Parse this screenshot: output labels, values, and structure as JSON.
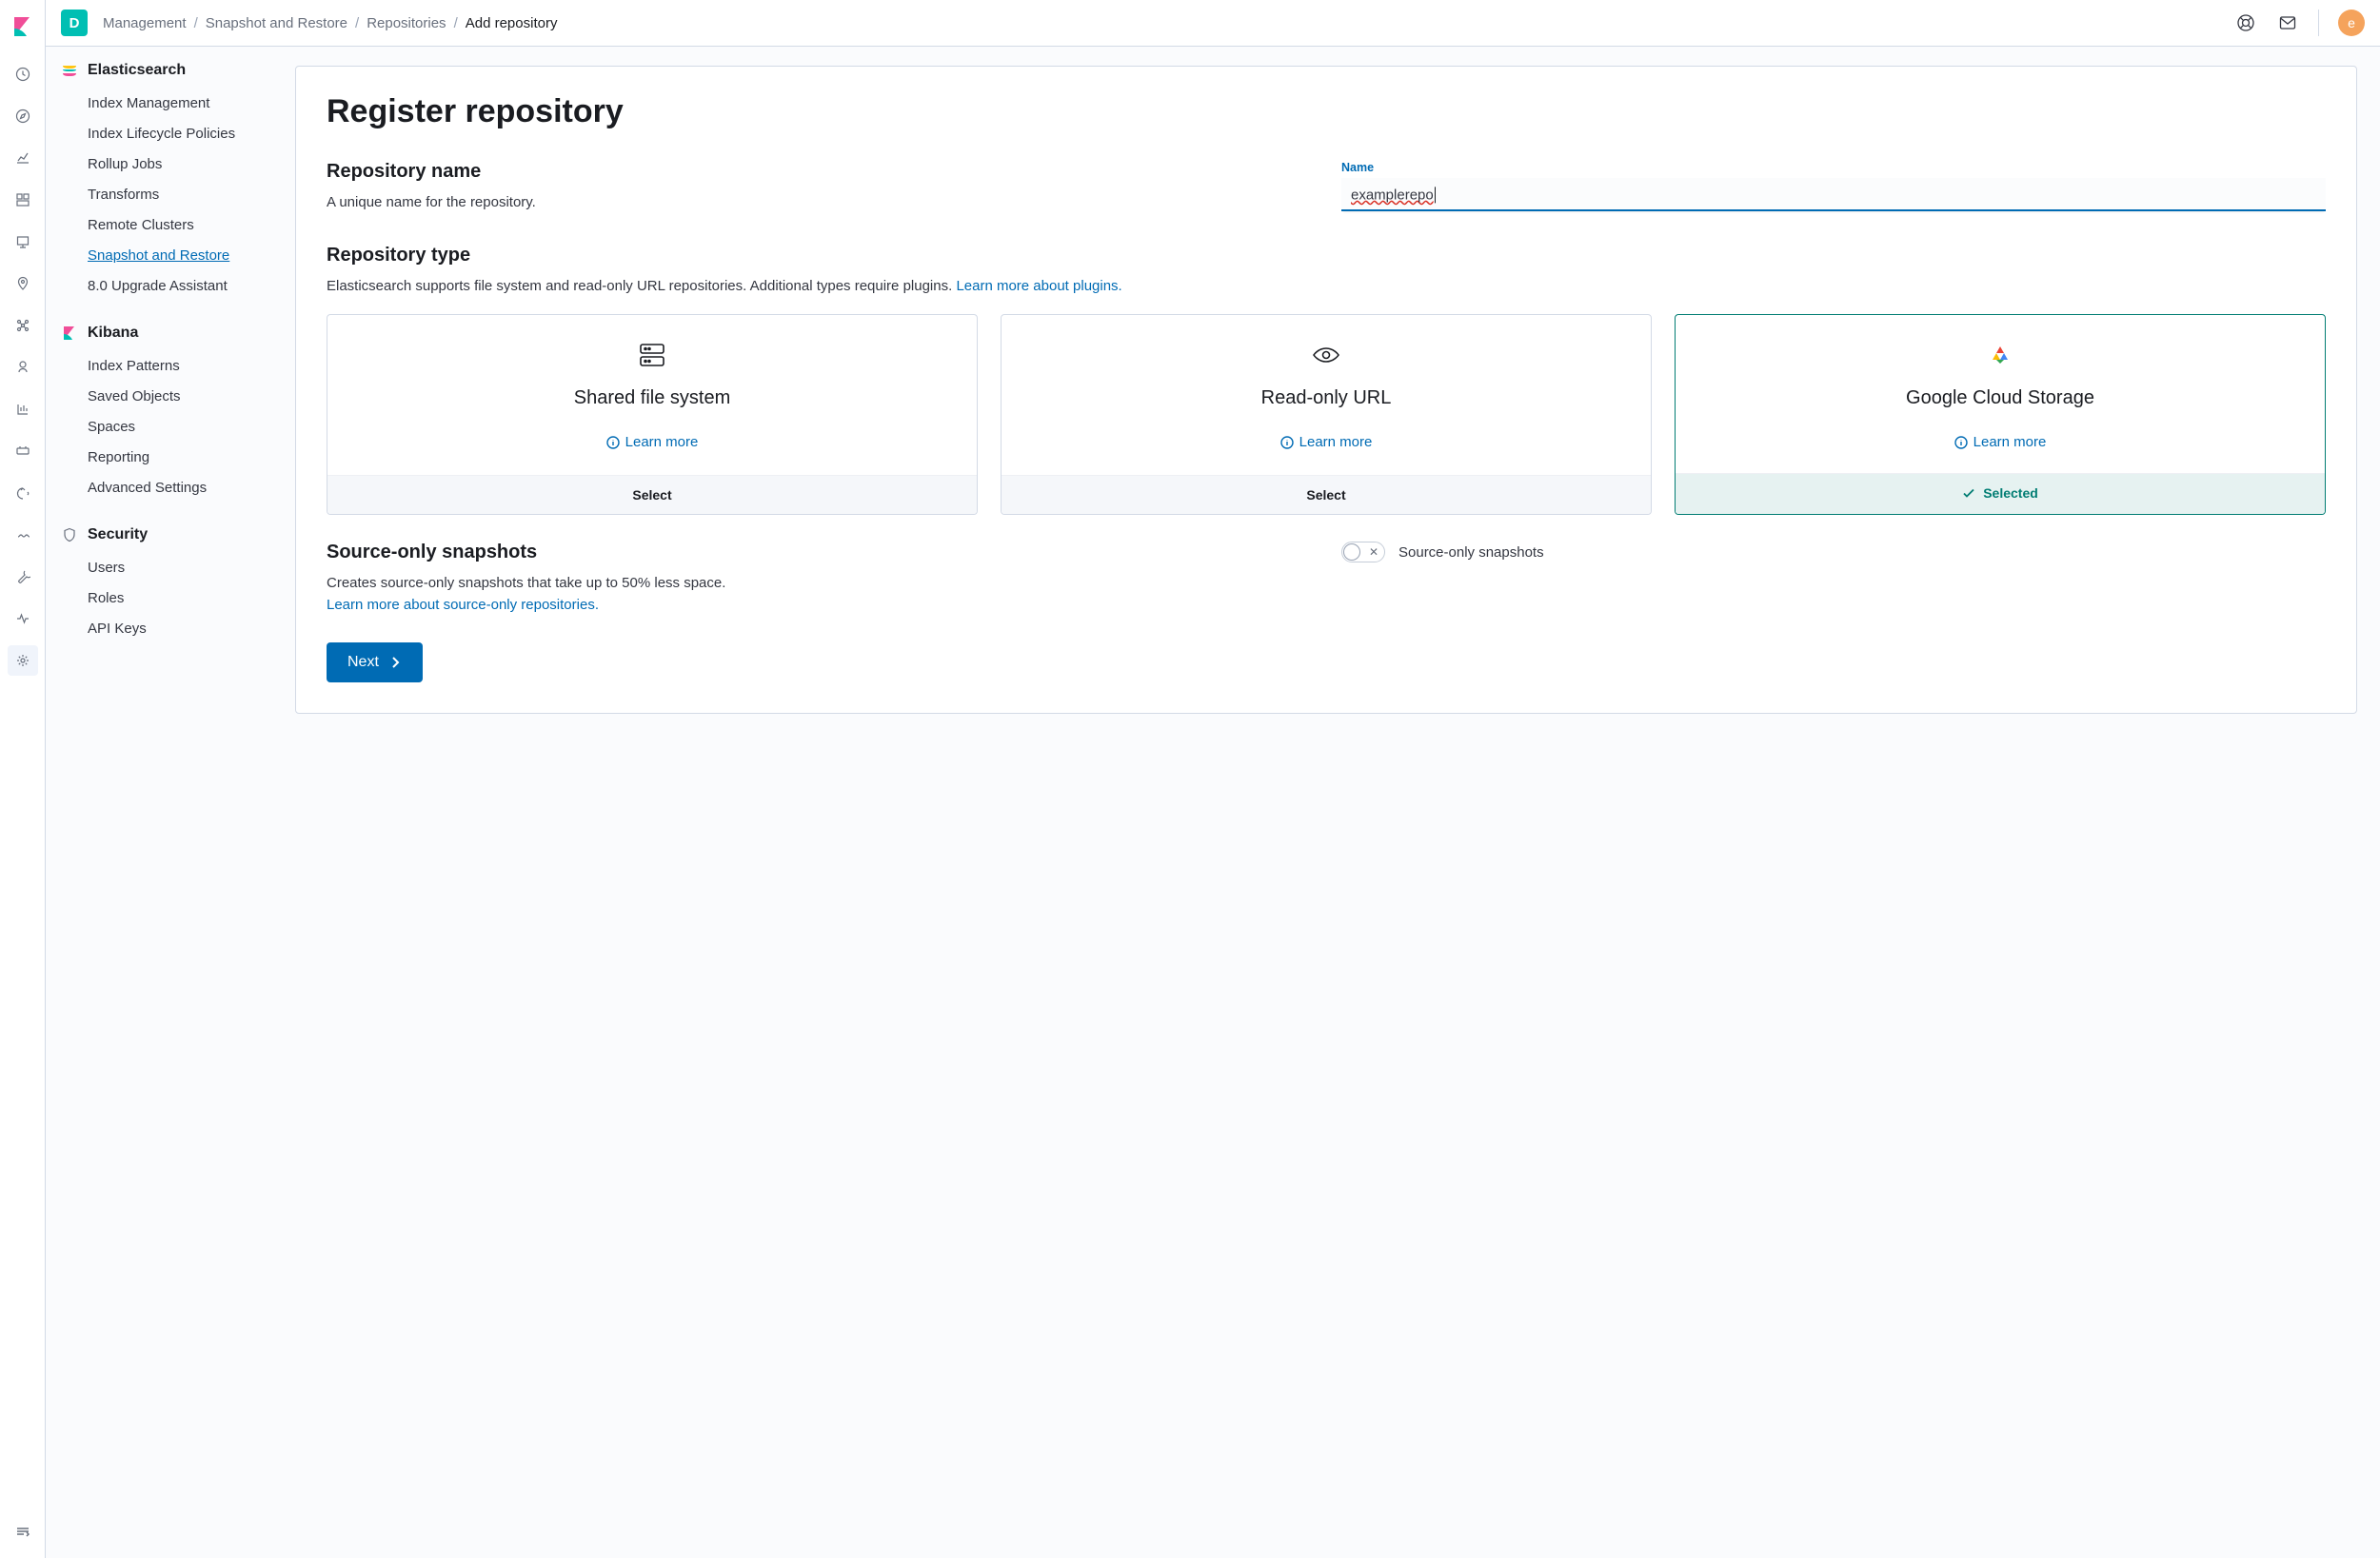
{
  "header": {
    "space_initial": "D",
    "breadcrumb": [
      "Management",
      "Snapshot and Restore",
      "Repositories",
      "Add repository"
    ],
    "avatar_initial": "e"
  },
  "side": {
    "sections": [
      {
        "title": "Elasticsearch",
        "items": [
          "Index Management",
          "Index Lifecycle Policies",
          "Rollup Jobs",
          "Transforms",
          "Remote Clusters",
          "Snapshot and Restore",
          "8.0 Upgrade Assistant"
        ],
        "active_index": 5
      },
      {
        "title": "Kibana",
        "items": [
          "Index Patterns",
          "Saved Objects",
          "Spaces",
          "Reporting",
          "Advanced Settings"
        ],
        "active_index": -1
      },
      {
        "title": "Security",
        "items": [
          "Users",
          "Roles",
          "API Keys"
        ],
        "active_index": -1
      }
    ]
  },
  "page": {
    "title": "Register repository",
    "name_section": {
      "title": "Repository name",
      "desc": "A unique name for the repository."
    },
    "name_field": {
      "label": "Name",
      "value": "examplerepo"
    },
    "type_section": {
      "title": "Repository type",
      "desc_prefix": "Elasticsearch supports file system and read-only URL repositories. Additional types require plugins. ",
      "desc_link": "Learn more about plugins."
    },
    "cards": [
      {
        "title": "Shared file system",
        "learn": "Learn more",
        "footer": "Select",
        "selected": false
      },
      {
        "title": "Read-only URL",
        "learn": "Learn more",
        "footer": "Select",
        "selected": false
      },
      {
        "title": "Google Cloud Storage",
        "learn": "Learn more",
        "footer": "Selected",
        "selected": true
      }
    ],
    "source_only": {
      "title": "Source-only snapshots",
      "desc": "Creates source-only snapshots that take up to 50% less space.",
      "link": "Learn more about source-only repositories.",
      "toggle_label": "Source-only snapshots"
    },
    "next_button": "Next"
  }
}
